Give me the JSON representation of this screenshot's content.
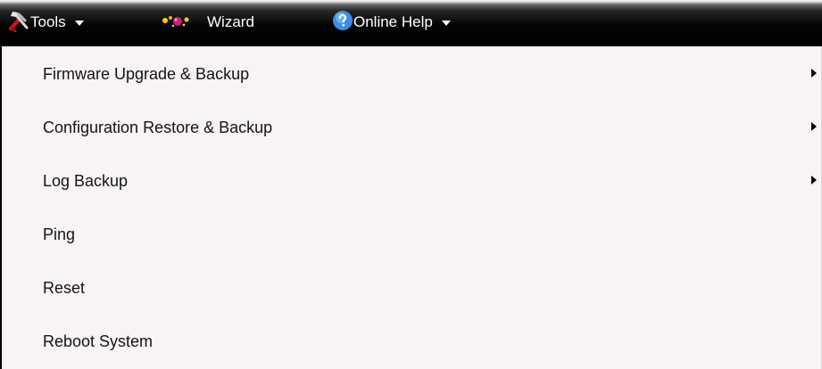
{
  "toolbar": {
    "tools": {
      "label": "Tools",
      "icon": "tools-icon"
    },
    "wizard": {
      "label": "Wizard",
      "icon": "wizard-icon"
    },
    "online_help": {
      "label": "Online Help",
      "icon": "help-icon"
    }
  },
  "tools_menu": {
    "items": [
      {
        "label": "Firmware Upgrade & Backup",
        "has_submenu": true
      },
      {
        "label": "Configuration Restore & Backup",
        "has_submenu": true
      },
      {
        "label": "Log Backup",
        "has_submenu": true
      },
      {
        "label": "Ping",
        "has_submenu": false
      },
      {
        "label": "Reset",
        "has_submenu": false
      },
      {
        "label": "Reboot System",
        "has_submenu": false
      }
    ]
  },
  "colors": {
    "toolbar_bg": "#000000",
    "toolbar_text": "#ffffff",
    "menu_bg": "#f7f3f7",
    "menu_text": "#141414"
  }
}
